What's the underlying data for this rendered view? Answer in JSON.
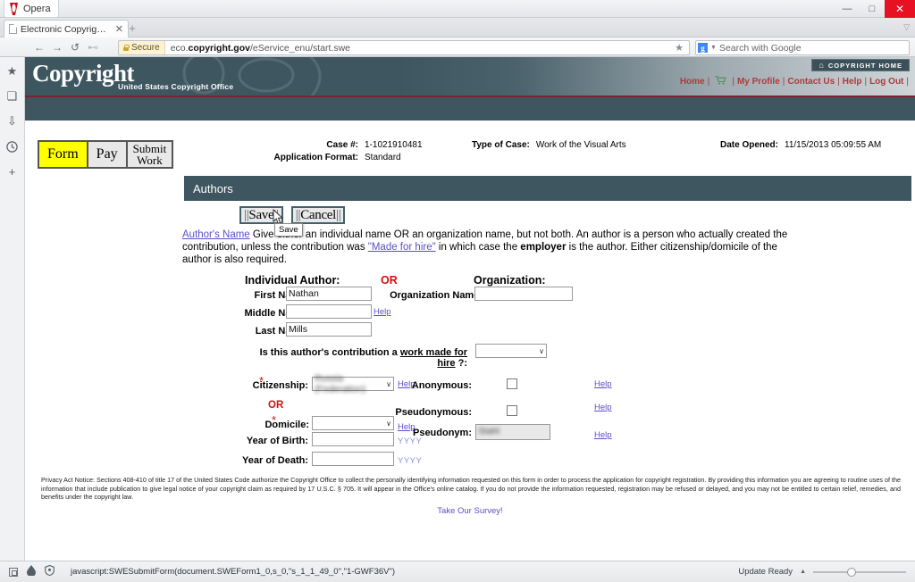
{
  "window": {
    "app_name": "Opera",
    "minimize": "—",
    "maximize": "□",
    "close": "✕"
  },
  "tab": {
    "title": "Electronic Copyright O...",
    "close": "✕",
    "new_tab": "+"
  },
  "nav": {
    "back": "←",
    "forward": "→",
    "reload": "↺",
    "extra": "⊷",
    "secure_label": "Secure",
    "url_prefix": "eco.",
    "url_domain": "copyright.gov",
    "url_path": "/eService_enu/start.swe",
    "star": "★",
    "search_placeholder": "Search with Google",
    "search_engine_letter": "g"
  },
  "sidebar": {
    "items": [
      {
        "name": "speed-dial-icon",
        "glyph": "★"
      },
      {
        "name": "bookmarks-icon",
        "glyph": "❏"
      },
      {
        "name": "downloads-icon",
        "glyph": "⇩"
      },
      {
        "name": "history-icon",
        "glyph": "🕐"
      },
      {
        "name": "add-icon",
        "glyph": "+"
      }
    ]
  },
  "banner": {
    "logo_c": "C",
    "logo_text": "opyright",
    "subtitle": "United States Copyright Office",
    "copyright_home": "COPYRIGHT HOME",
    "house_icon": "⌂",
    "links": [
      "Home",
      "My Profile",
      "Contact Us",
      "Help",
      "Log Out"
    ],
    "cart_icon": "🛒",
    "separator": "|",
    "accent_red": "#b03a3a",
    "banner_dark": "#3d5660",
    "rule_red": "#7e2230"
  },
  "steps": {
    "tabs": [
      {
        "label": "Form",
        "active": true
      },
      {
        "label": "Pay",
        "active": false
      },
      {
        "label": "Submit Work",
        "line1": "Submit",
        "line2": "Work",
        "active": false
      }
    ]
  },
  "case": {
    "case_number_label": "Case #:",
    "case_number_value": "1-1021910481",
    "application_format_label": "Application Format:",
    "application_format_value": "Standard",
    "type_of_case_label": "Type of Case:",
    "type_of_case_value": "Work of the Visual Arts",
    "date_opened_label": "Date Opened:",
    "date_opened_value": "11/15/2013 05:09:55 AM"
  },
  "section": {
    "title": "Authors"
  },
  "actions": {
    "save": "Save",
    "cancel": "Cancel",
    "bar": "|",
    "tooltip": "Save"
  },
  "instructions": {
    "link": "Author's Name",
    "text_1": " Give either an individual name OR an organization name, but not both. An author is a person who actually created the contribution, unless the contribution was ",
    "made_for_hire": "\"Made for hire\"",
    "text_2": " in which case the ",
    "employer": "employer",
    "text_3": " is the author. Either citizenship/domicile of the author is also required."
  },
  "form": {
    "individual_author_heading": "Individual Author:",
    "or_divider": "OR",
    "organization_heading": "Organization:",
    "first_name_label": "First Name:",
    "first_name_value": "Nathan",
    "middle_name_label": "Middle Name:",
    "middle_name_value": "",
    "last_name_label": "Last Name:",
    "last_name_value": "Mills",
    "organization_name_label": "Organization Name:",
    "organization_name_value": "",
    "work_for_hire_prefix": "Is this author's contribution a ",
    "work_for_hire_link": "work made for hire",
    "work_for_hire_suffix": " ?:",
    "work_for_hire_value": "",
    "citizenship_label": "Citizenship:",
    "citizenship_value": "Russia (Federation)",
    "or_label": "OR",
    "domicile_label": "Domicile:",
    "domicile_value": "",
    "year_of_birth_label": "Year of Birth:",
    "year_of_birth_value": "",
    "year_of_death_label": "Year of Death:",
    "year_of_death_value": "",
    "yyyy_hint": "YYYY",
    "anonymous_label": "Anonymous:",
    "anonymous_checked": false,
    "pseudonymous_label": "Pseudonymous:",
    "pseudonymous_checked": false,
    "pseudonym_label": "Pseudonym:",
    "pseudonym_value": "Stahl",
    "help_label": "Help",
    "required_marker": "*",
    "select_arrow": "∨"
  },
  "privacy": {
    "text": "Privacy Act Notice: Sections 408-410 of title 17 of the United States Code authorize the Copyright Office to collect the personally identifying information requested on this form in order to process the application for copyright registration. By providing this information you are agreeing to routine uses of the information that include publication to give legal notice of your copyright claim as required by 17 U.S.C. § 705. It will appear in the Office's online catalog. If you do not provide the information requested, registration may be refused or delayed, and you may not be entitled to certain relief, remedies, and benefits under the copyright law.",
    "survey_link": "Take Our Survey!"
  },
  "statusbar": {
    "url": "javascript:SWESubmitForm(document.SWEForm1_0,s_0,\"s_1_1_49_0\",\"1-GWF36V\")",
    "update_status": "Update Ready",
    "caret": "▲"
  }
}
